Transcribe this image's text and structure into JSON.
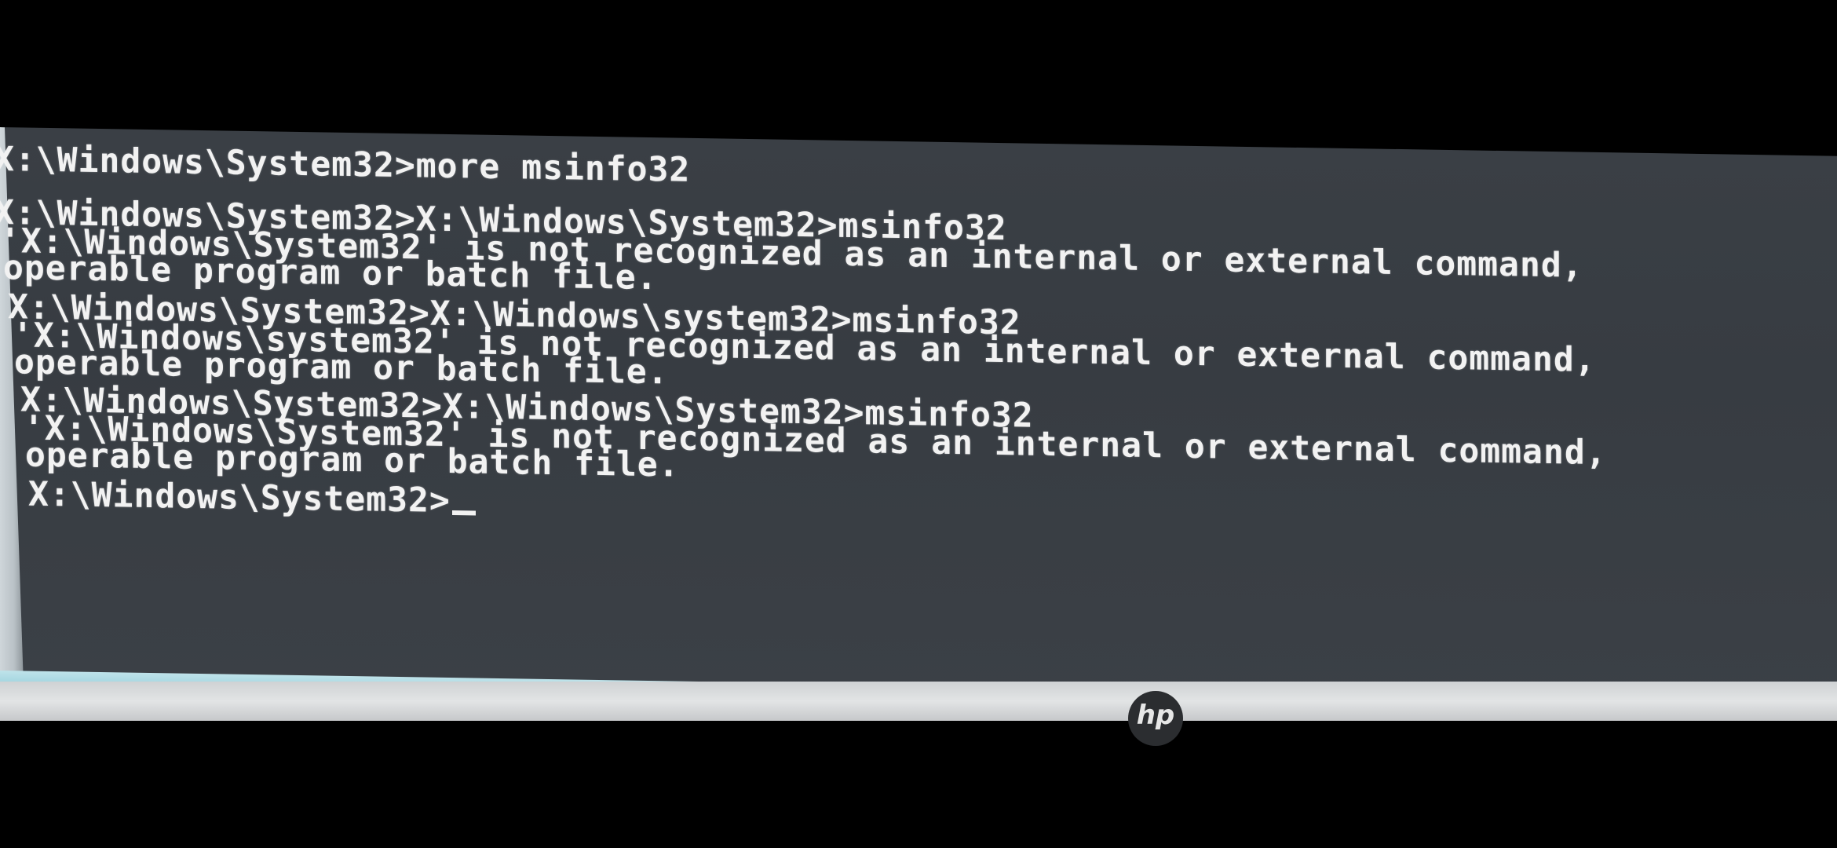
{
  "console": {
    "lines": [
      "X:\\Windows\\System32>more msinfo32",
      "X:\\Windows\\System32>X:\\Windows\\System32>msinfo32",
      "'X:\\Windows\\System32' is not recognized as an internal or external command,",
      "operable program or batch file.",
      "X:\\Windows\\System32>X:\\Windows\\system32>msinfo32",
      "'X:\\Windows\\system32' is not recognized as an internal or external command,",
      "operable program or batch file.",
      "X:\\Windows\\System32>X:\\Windows\\System32>msinfo32",
      "'X:\\Windows\\System32' is not recognized as an internal or external command,",
      "operable program or batch file.",
      "X:\\Windows\\System32>"
    ]
  },
  "monitor": {
    "brand": "hp"
  },
  "colors": {
    "console_background": "#3a3f45",
    "console_text": "#f2f2f2",
    "bezel": "#d8dadb",
    "window_border": "#a8d8e2"
  }
}
